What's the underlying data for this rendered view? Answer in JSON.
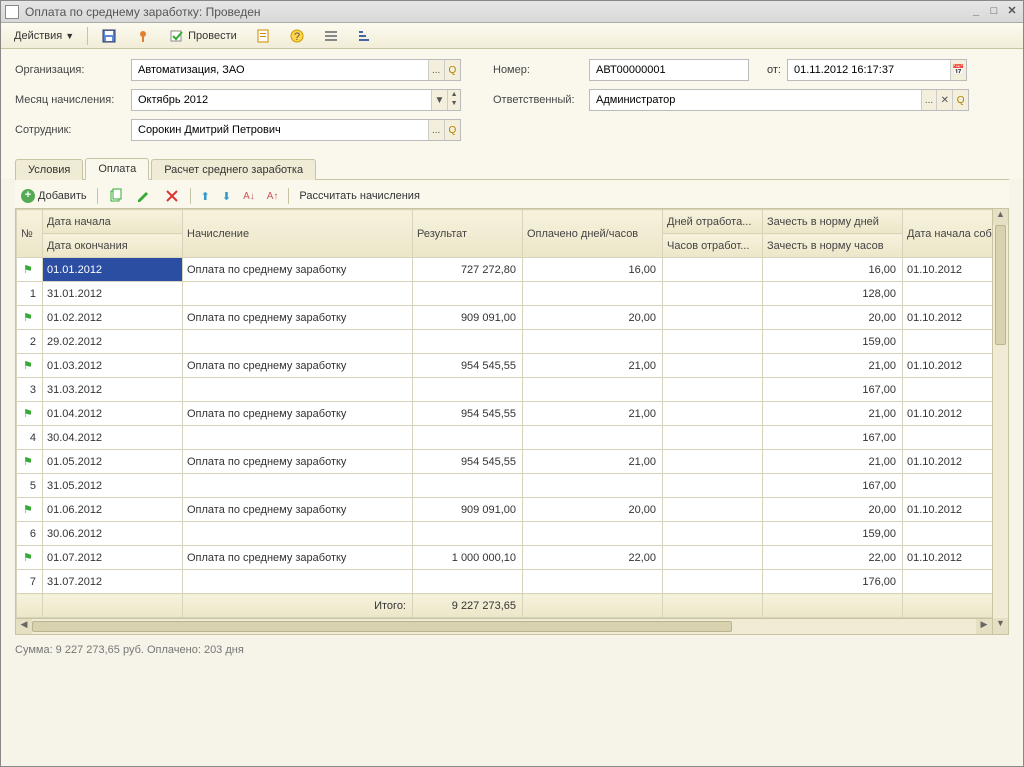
{
  "window": {
    "title": "Оплата по среднему заработку: Проведен"
  },
  "toolbar": {
    "actions": "Действия",
    "post": "Провести"
  },
  "form": {
    "org_label": "Организация:",
    "org_value": "Автоматизация, ЗАО",
    "month_label": "Месяц начисления:",
    "month_value": "Октябрь 2012",
    "emp_label": "Сотрудник:",
    "emp_value": "Сорокин Дмитрий Петрович",
    "num_label": "Номер:",
    "num_value": "АВТ00000001",
    "from_label": "от:",
    "from_value": "01.11.2012 16:17:37",
    "resp_label": "Ответственный:",
    "resp_value": "Администратор"
  },
  "tabs": {
    "t1": "Условия",
    "t2": "Оплата",
    "t3": "Расчет среднего заработка"
  },
  "inner": {
    "add": "Добавить",
    "calc": "Рассчитать начисления"
  },
  "headers": {
    "n": "№",
    "date_start": "Дата начала",
    "date_end": "Дата окончания",
    "acc": "Начисление",
    "res": "Результат",
    "paid": "Оплачено дней/часов",
    "days_worked": "Дней отработа...",
    "hours_worked": "Часов отработ...",
    "norm_days": "Зачесть в норму дней",
    "norm_hours": "Зачесть в норму часов",
    "event": "Дата начала события",
    "total": "Итого:"
  },
  "rows": [
    {
      "n": "1",
      "d1": "01.01.2012",
      "d2": "31.01.2012",
      "acc": "Оплата по среднему заработку",
      "res": "727 272,80",
      "paid": "16,00",
      "nd": "16,00",
      "nh": "128,00",
      "ev": "01.10.2012"
    },
    {
      "n": "2",
      "d1": "01.02.2012",
      "d2": "29.02.2012",
      "acc": "Оплата по среднему заработку",
      "res": "909 091,00",
      "paid": "20,00",
      "nd": "20,00",
      "nh": "159,00",
      "ev": "01.10.2012"
    },
    {
      "n": "3",
      "d1": "01.03.2012",
      "d2": "31.03.2012",
      "acc": "Оплата по среднему заработку",
      "res": "954 545,55",
      "paid": "21,00",
      "nd": "21,00",
      "nh": "167,00",
      "ev": "01.10.2012"
    },
    {
      "n": "4",
      "d1": "01.04.2012",
      "d2": "30.04.2012",
      "acc": "Оплата по среднему заработку",
      "res": "954 545,55",
      "paid": "21,00",
      "nd": "21,00",
      "nh": "167,00",
      "ev": "01.10.2012"
    },
    {
      "n": "5",
      "d1": "01.05.2012",
      "d2": "31.05.2012",
      "acc": "Оплата по среднему заработку",
      "res": "954 545,55",
      "paid": "21,00",
      "nd": "21,00",
      "nh": "167,00",
      "ev": "01.10.2012"
    },
    {
      "n": "6",
      "d1": "01.06.2012",
      "d2": "30.06.2012",
      "acc": "Оплата по среднему заработку",
      "res": "909 091,00",
      "paid": "20,00",
      "nd": "20,00",
      "nh": "159,00",
      "ev": "01.10.2012"
    },
    {
      "n": "7",
      "d1": "01.07.2012",
      "d2": "31.07.2012",
      "acc": "Оплата по среднему заработку",
      "res": "1 000 000,10",
      "paid": "22,00",
      "nd": "22,00",
      "nh": "176,00",
      "ev": "01.10.2012"
    }
  ],
  "total_res": "9 227 273,65",
  "status": "Сумма: 9 227 273,65 руб. Оплачено: 203 дня"
}
